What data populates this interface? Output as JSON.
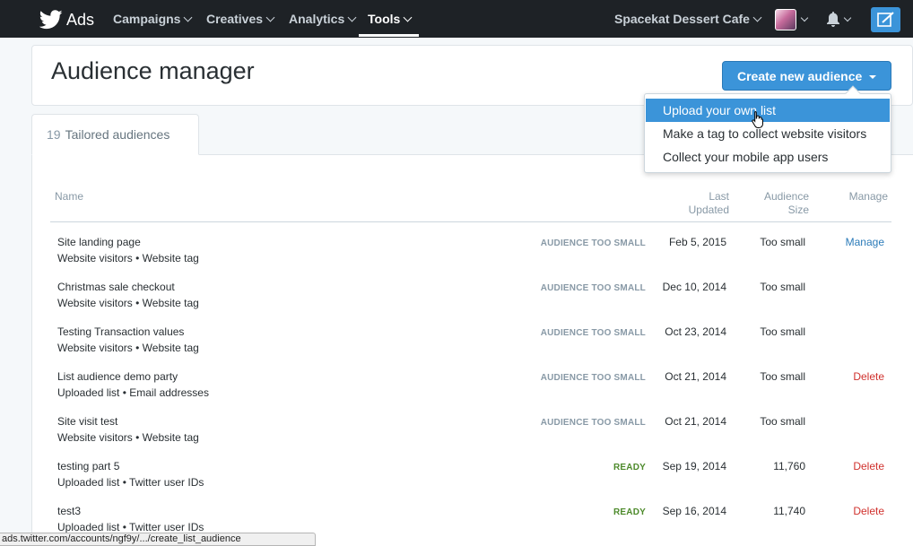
{
  "nav": {
    "brand": "Ads",
    "items": [
      {
        "label": "Campaigns",
        "active": false
      },
      {
        "label": "Creatives",
        "active": false
      },
      {
        "label": "Analytics",
        "active": false
      },
      {
        "label": "Tools",
        "active": true
      }
    ],
    "account": "Spacekat Dessert Cafe",
    "icons": [
      "twitter-bird-icon",
      "avatar",
      "bell-icon",
      "compose-icon"
    ]
  },
  "header": {
    "title": "Audience manager",
    "create_button": "Create new audience"
  },
  "dropdown": {
    "items": [
      {
        "label": "Upload your own list",
        "highlighted": true
      },
      {
        "label": "Make a tag to collect website visitors",
        "highlighted": false
      },
      {
        "label": "Collect your mobile app users",
        "highlighted": false
      }
    ]
  },
  "tab": {
    "count": "19",
    "label": "Tailored audiences"
  },
  "table": {
    "columns": {
      "name": "Name",
      "last_updated_1": "Last",
      "last_updated_2": "Updated",
      "size_1": "Audience",
      "size_2": "Size",
      "manage": "Manage"
    },
    "rows": [
      {
        "name": "Site landing page",
        "sub": "Website visitors • Website tag",
        "status": "AUDIENCE TOO SMALL",
        "status_kind": "small",
        "updated": "Feb 5, 2015",
        "size": "Too small",
        "action": "Manage",
        "action_kind": "manage"
      },
      {
        "name": "Christmas sale checkout",
        "sub": "Website visitors • Website tag",
        "status": "AUDIENCE TOO SMALL",
        "status_kind": "small",
        "updated": "Dec 10, 2014",
        "size": "Too small",
        "action": "",
        "action_kind": ""
      },
      {
        "name": "Testing Transaction values",
        "sub": "Website visitors • Website tag",
        "status": "AUDIENCE TOO SMALL",
        "status_kind": "small",
        "updated": "Oct 23, 2014",
        "size": "Too small",
        "action": "",
        "action_kind": ""
      },
      {
        "name": "List audience demo party",
        "sub": "Uploaded list • Email addresses",
        "status": "AUDIENCE TOO SMALL",
        "status_kind": "small",
        "updated": "Oct 21, 2014",
        "size": "Too small",
        "action": "Delete",
        "action_kind": "delete"
      },
      {
        "name": "Site visit test",
        "sub": "Website visitors • Website tag",
        "status": "AUDIENCE TOO SMALL",
        "status_kind": "small",
        "updated": "Oct 21, 2014",
        "size": "Too small",
        "action": "",
        "action_kind": ""
      },
      {
        "name": "testing part 5",
        "sub": "Uploaded list • Twitter user IDs",
        "status": "READY",
        "status_kind": "ready",
        "updated": "Sep 19, 2014",
        "size": "11,760",
        "action": "Delete",
        "action_kind": "delete"
      },
      {
        "name": "test3",
        "sub": "Uploaded list • Twitter user IDs",
        "status": "READY",
        "status_kind": "ready",
        "updated": "Sep 16, 2014",
        "size": "11,740",
        "action": "Delete",
        "action_kind": "delete"
      }
    ]
  },
  "statusbar": {
    "url": "ads.twitter.com/accounts/ngf9y/.../create_list_audience"
  },
  "colors": {
    "accent": "#3b94d9",
    "nav_bg": "#1e2226",
    "ready": "#4d8a2b",
    "delete": "#d0312d",
    "link": "#2b7bb9"
  }
}
